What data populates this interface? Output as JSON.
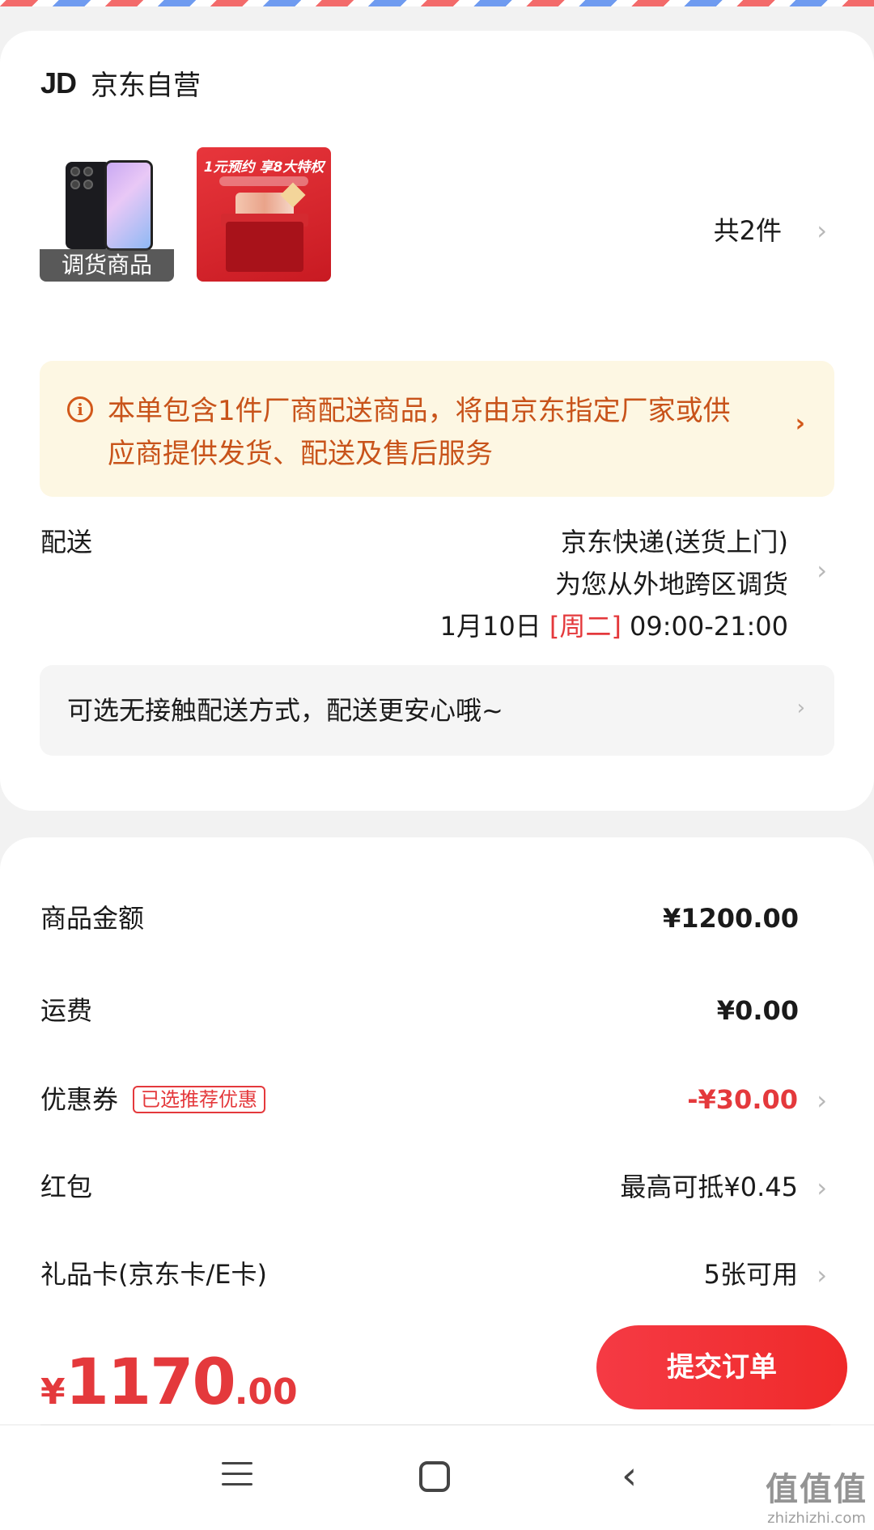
{
  "shop": {
    "logo": "JD",
    "name": "京东自营",
    "items": [
      {
        "tag": "调货商品",
        "icon": "phone-product-image"
      },
      {
        "title": "1元预约 享8大特权",
        "icon": "gift-box-promo-image"
      }
    ],
    "count": "共2件"
  },
  "notice": {
    "icon": "info-icon",
    "text": "本单包含1件厂商配送商品，将由京东指定厂家或供应商提供发货、配送及售后服务"
  },
  "delivery": {
    "label": "配送",
    "method": "京东快递(送货上门)",
    "note": "为您从外地跨区调货",
    "date": "1月10日",
    "weekday": "[周二]",
    "time": "09:00-21:00"
  },
  "contactless": {
    "text": "可选无接触配送方式，配送更安心哦~"
  },
  "price_rows": [
    {
      "label": "商品金额",
      "value": "¥1200.00"
    },
    {
      "label": "运费",
      "value": "¥0.00"
    },
    {
      "label": "优惠券",
      "tag": "已选推荐优惠",
      "value": "-¥30.00"
    },
    {
      "label": "红包",
      "value": "最高可抵¥0.45"
    },
    {
      "label": "礼品卡(京东卡/E卡)",
      "value": "5张可用"
    }
  ],
  "total": {
    "currency": "¥",
    "integer": "1170",
    "decimal": ".00"
  },
  "submit_label": "提交订单",
  "watermark": {
    "logo": "值值值",
    "url": "zhizhizhi.com"
  },
  "colors": {
    "accent": "#e4393c",
    "notice_bg": "#fdf7e3",
    "notice_text": "#c8531a"
  }
}
